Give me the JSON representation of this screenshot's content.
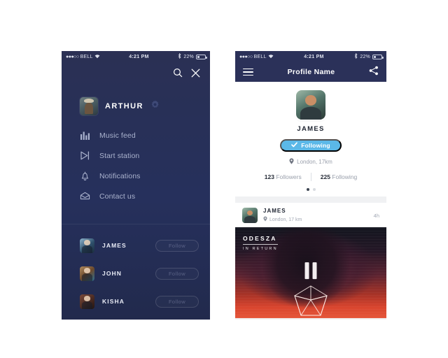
{
  "left_phone": {
    "status_bar": {
      "signal_dots": "●●●○○",
      "carrier": "BELL",
      "wifi_icon": "wifi-icon",
      "time": "4:21 PM",
      "bluetooth_icon": "bluetooth-icon",
      "battery": "22%"
    },
    "top_actions": [
      {
        "name": "search-icon",
        "label": "Search"
      },
      {
        "name": "close-icon",
        "label": "Close"
      }
    ],
    "profile": {
      "name": "ARTHUR",
      "avatar": "user-avatar",
      "settings_icon": "gear-icon"
    },
    "menu": [
      {
        "icon": "bar-chart-icon",
        "label": "Music feed"
      },
      {
        "icon": "play-skip-icon",
        "label": "Start station"
      },
      {
        "icon": "bell-icon",
        "label": "Notifications"
      },
      {
        "icon": "envelope-icon",
        "label": "Contact us"
      }
    ],
    "friends": [
      {
        "name": "JAMES",
        "action": "Follow"
      },
      {
        "name": "JOHN",
        "action": "Follow"
      },
      {
        "name": "KISHA",
        "action": "Follow"
      }
    ]
  },
  "right_phone": {
    "status_bar": {
      "signal_dots": "●●●○○",
      "carrier": "BELL",
      "wifi_icon": "wifi-icon",
      "time": "4:21 PM",
      "bluetooth_icon": "bluetooth-icon",
      "battery": "22%"
    },
    "nav": {
      "menu_icon": "hamburger-icon",
      "title": "Profile Name",
      "share_icon": "share-icon"
    },
    "profile": {
      "avatar": "user-avatar",
      "name": "JAMES",
      "follow_state": "Following",
      "check_icon": "check-icon",
      "location_icon": "location-pin-icon",
      "location": "London, 17km",
      "followers_count": "123",
      "followers_label": "Followers",
      "following_count": "225",
      "following_label": "Following",
      "page_dots": 2,
      "active_dot": 1
    },
    "feed": {
      "author": "JAMES",
      "location_icon": "location-pin-icon",
      "location": "London, 17 km",
      "time": "4h",
      "album": {
        "artist": "ODESZA",
        "title": "IN RETURN",
        "playback_icon": "pause-icon",
        "logo_icon": "icosahedron-icon"
      }
    }
  },
  "colors": {
    "sidebar_navy": "#26305c",
    "navbar_navy": "#2b3159",
    "accent_blue": "#5bb8e8",
    "page_background": "#ffffff",
    "card_background": "#ffffff",
    "muted_text": "#9aa0ac"
  }
}
